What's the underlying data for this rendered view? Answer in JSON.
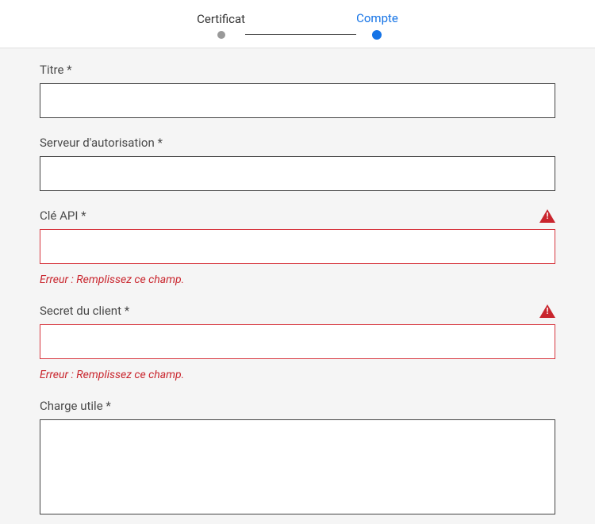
{
  "stepper": {
    "step1": "Certificat",
    "step2": "Compte"
  },
  "fields": {
    "title": {
      "label": "Titre *",
      "value": ""
    },
    "authServer": {
      "label": "Serveur d'autorisation *",
      "value": ""
    },
    "apiKey": {
      "label": "Clé API *",
      "value": "",
      "error": "Erreur : Remplissez ce champ."
    },
    "clientSecret": {
      "label": "Secret du client *",
      "value": "",
      "error": "Erreur : Remplissez ce champ."
    },
    "payload": {
      "label": "Charge utile *",
      "value": ""
    }
  }
}
